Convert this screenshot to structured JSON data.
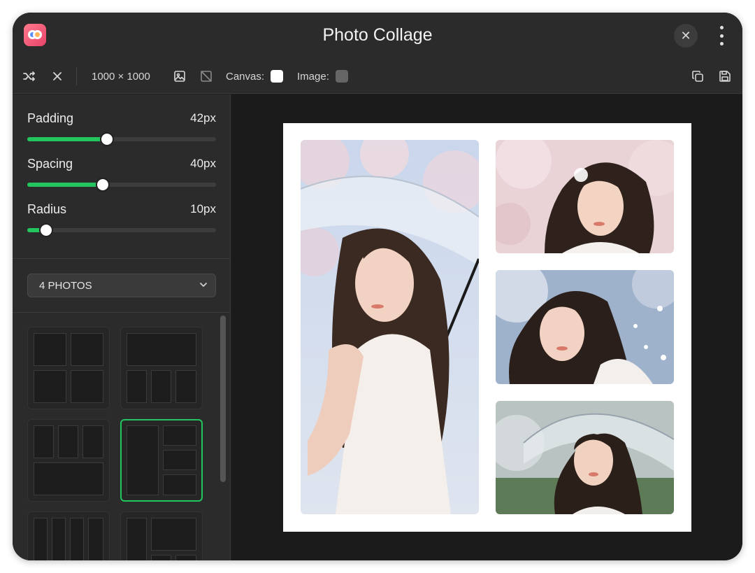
{
  "window": {
    "title": "Photo Collage"
  },
  "toolbar": {
    "dimensions": "1000 × 1000",
    "canvas_label": "Canvas:",
    "canvas_color": "#ffffff",
    "image_label": "Image:",
    "image_color": "#666666"
  },
  "sliders": [
    {
      "label": "Padding",
      "value": "42px",
      "fraction": 0.42
    },
    {
      "label": "Spacing",
      "value": "40px",
      "fraction": 0.4
    },
    {
      "label": "Radius",
      "value": "10px",
      "fraction": 0.1
    }
  ],
  "photo_count": {
    "selected": "4 PHOTOS"
  },
  "accent_color": "#22c55e",
  "icons": [
    "shuffle-icon",
    "close-icon",
    "image-icon",
    "no-image-icon",
    "duplicate-icon",
    "save-icon",
    "more-icon",
    "chevron-down-icon"
  ]
}
